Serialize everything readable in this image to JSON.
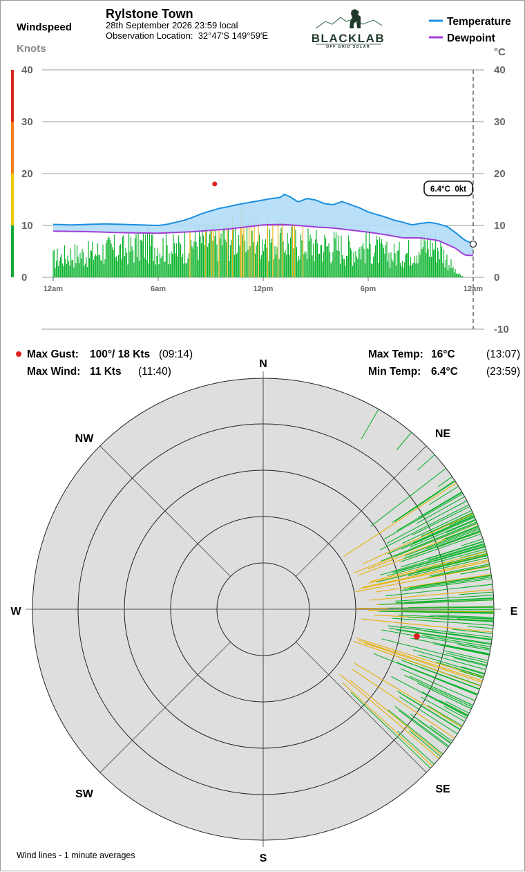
{
  "header": {
    "station_name": "Rylstone Town",
    "datetime": "28th September 2026  23:59 local",
    "location_label": "Observation Location:",
    "location": "32°47'S 149°59'E"
  },
  "logo": {
    "name": "BLACKLAB",
    "tagline": "OFF GRID SOLAR",
    "colors": {
      "dark": "#1f3a2a",
      "accent": "#4a7a5a"
    }
  },
  "left_axis": {
    "title": "Windspeed",
    "unit": "Knots",
    "ticks": [
      "40",
      "30",
      "20",
      "10",
      "0"
    ]
  },
  "right_axis": {
    "unit": "°C",
    "ticks": [
      "40",
      "30",
      "20",
      "10",
      "0",
      "-10"
    ]
  },
  "legend": {
    "items": [
      {
        "label": "Temperature",
        "color": "#1a8fe0"
      },
      {
        "label": "Dewpoint",
        "color": "#a23ed6"
      }
    ]
  },
  "current_badge": "6.4°C  0kt",
  "stats": {
    "max_gust": {
      "label": "Max Gust:",
      "value": "100°/  18 Kts",
      "time": "(09:14)"
    },
    "max_wind": {
      "label": "Max Wind:",
      "value": "11 Kts",
      "time": "(11:40)"
    },
    "max_temp": {
      "label": "Max Temp:",
      "value": "16°C",
      "time": "(13:07)"
    },
    "min_temp": {
      "label": "Min Temp:",
      "value": "6.4°C",
      "time": "(23:59)"
    }
  },
  "compass": {
    "N": "N",
    "NE": "NE",
    "E": "E",
    "SE": "SE",
    "S": "S",
    "SW": "SW",
    "W": "W",
    "NW": "NW"
  },
  "footnote": "Wind lines - 1 minute averages",
  "colors": {
    "wind_normal": "#0db32e",
    "wind_strong": "#e8b007",
    "gust_marker": "#e02020",
    "temp_line": "#1a8fe0",
    "temp_fill": "#b3dcf7",
    "dew_line": "#a23ed6",
    "band_green": "#13a838",
    "band_yellow": "#f2c811",
    "band_orange": "#f07f1e",
    "band_red": "#d52a1e",
    "rose_bg": "#dedede"
  },
  "chart_data": {
    "type": "line",
    "x_label_ticks": [
      "12am",
      "6am",
      "12pm",
      "6pm",
      "12am"
    ],
    "x_tick_hours": [
      0,
      6,
      12,
      18,
      24
    ],
    "xlim_hours": [
      0,
      24
    ],
    "wind_ylim": [
      0,
      40
    ],
    "temp_ylim": [
      -10,
      40
    ],
    "grid": true,
    "series": [
      {
        "name": "Temperature",
        "unit": "°C",
        "x_hours": [
          0,
          1,
          2,
          3,
          4,
          5,
          6,
          6.5,
          7,
          7.5,
          8,
          8.5,
          9,
          9.5,
          10,
          10.5,
          11,
          11.5,
          12,
          12.5,
          13,
          13.2,
          13.5,
          14,
          14.5,
          15,
          15.5,
          16,
          16.5,
          17,
          17.5,
          18,
          18.5,
          19,
          19.5,
          20,
          20.5,
          21,
          21.5,
          22,
          22.5,
          23,
          23.5,
          24
        ],
        "values": [
          10.2,
          10.1,
          10.2,
          10.3,
          10.2,
          10.1,
          10.0,
          10.2,
          10.6,
          11.0,
          11.6,
          12.3,
          12.8,
          13.3,
          13.6,
          14.0,
          14.3,
          14.6,
          14.9,
          15.2,
          15.4,
          16.0,
          15.6,
          14.5,
          15.2,
          14.9,
          14.2,
          14.0,
          14.6,
          14.0,
          13.4,
          12.6,
          12.1,
          11.6,
          11.0,
          10.6,
          10.1,
          10.4,
          10.6,
          10.3,
          9.8,
          8.6,
          7.2,
          6.4
        ]
      },
      {
        "name": "Dewpoint",
        "unit": "°C",
        "x_hours": [
          0,
          2,
          4,
          6,
          8,
          10,
          11,
          12,
          13,
          14,
          15,
          16,
          17,
          18,
          19,
          20,
          21,
          22,
          23,
          23.5,
          24
        ],
        "values": [
          8.9,
          8.8,
          8.6,
          8.5,
          8.8,
          9.3,
          9.7,
          10.1,
          10.2,
          10.0,
          9.7,
          9.5,
          9.1,
          8.7,
          8.2,
          7.6,
          7.6,
          7.1,
          5.6,
          4.3,
          4.2
        ]
      },
      {
        "name": "Wind",
        "unit": "Kts",
        "x_hours": [
          0,
          1,
          2,
          3,
          4,
          5,
          6,
          7,
          8,
          9,
          10,
          11,
          12,
          13,
          14,
          15,
          16,
          17,
          18,
          19,
          20,
          21,
          22,
          22.5,
          23,
          23.5,
          24
        ],
        "values": [
          4,
          5,
          5,
          6,
          6,
          7,
          7,
          6,
          8,
          8,
          9,
          10,
          9,
          8,
          8,
          7,
          7,
          6,
          7,
          5,
          5,
          7,
          7,
          4,
          1,
          0,
          0
        ]
      },
      {
        "name": "Max Gust",
        "unit": "Kts",
        "x_hours": [
          9.23
        ],
        "values": [
          18
        ]
      }
    ],
    "wind_direction_deg": {
      "range_deg": [
        55,
        140
      ],
      "dominant_deg": 90
    }
  }
}
